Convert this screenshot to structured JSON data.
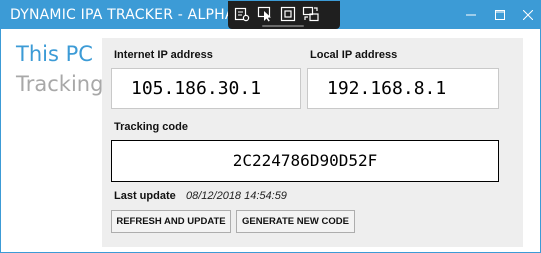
{
  "window": {
    "title": "DYNAMIC IPA TRACKER - ALPHA",
    "accent_color": "#3c9bd6",
    "controls": {
      "minimize_icon": "minimize-icon",
      "maximize_icon": "maximize-icon",
      "close_icon": "close-icon"
    }
  },
  "debug_toolbar": {
    "icons": [
      "live-tree-icon",
      "select-element-icon",
      "display-adorners-icon",
      "track-focus-icon"
    ]
  },
  "nav": {
    "items": [
      {
        "label": "This PC",
        "active": true
      },
      {
        "label": "Tracking",
        "active": false
      }
    ]
  },
  "main": {
    "internet_ip": {
      "label": "Internet IP address",
      "value": "105.186.30.1"
    },
    "local_ip": {
      "label": "Local IP address",
      "value": "192.168.8.1"
    },
    "tracking_code": {
      "label": "Tracking code",
      "value": "2C224786D90D52F"
    },
    "last_update": {
      "label": "Last update",
      "value": "08/12/2018 14:54:59"
    },
    "buttons": {
      "refresh": "REFRESH AND UPDATE",
      "generate": "GENERATE NEW CODE"
    }
  }
}
